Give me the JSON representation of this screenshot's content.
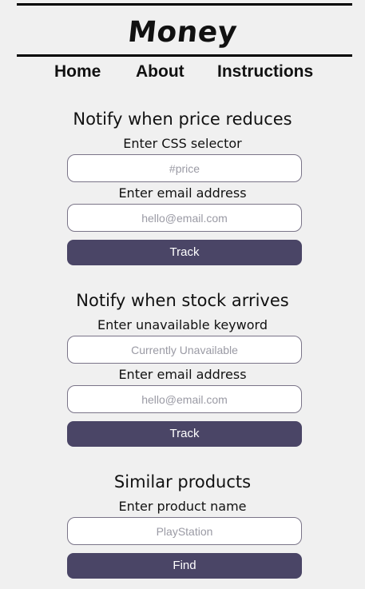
{
  "brand": {
    "title": "Money"
  },
  "nav": {
    "home": "Home",
    "about": "About",
    "instructions": "Instructions"
  },
  "price": {
    "title": "Notify when price reduces",
    "selector_label": "Enter CSS selector",
    "selector_placeholder": "#price",
    "email_label": "Enter email address",
    "email_placeholder": "hello@email.com",
    "button": "Track"
  },
  "stock": {
    "title": "Notify when stock arrives",
    "keyword_label": "Enter unavailable keyword",
    "keyword_placeholder": "Currently Unavailable",
    "email_label": "Enter email address",
    "email_placeholder": "hello@email.com",
    "button": "Track"
  },
  "similar": {
    "title": "Similar products",
    "product_label": "Enter product name",
    "product_placeholder": "PlayStation",
    "button": "Find"
  },
  "colors": {
    "background": "#f0f0f0",
    "button": "#4a4566",
    "field_border": "#7a7488"
  }
}
